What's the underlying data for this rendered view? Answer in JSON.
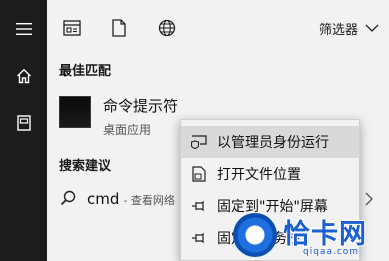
{
  "rail": {
    "items": [
      {
        "icon": "hamburger-menu-icon"
      },
      {
        "icon": "home-icon"
      },
      {
        "icon": "documents-icon"
      }
    ]
  },
  "topbar": {
    "icons": [
      "apps-icon",
      "document-icon",
      "web-icon"
    ],
    "filter_label": "筛选器"
  },
  "best_match": {
    "heading": "最佳匹配",
    "app_name": "命令提示符",
    "app_type": "桌面应用"
  },
  "suggestions": {
    "heading": "搜索建议",
    "query": "cmd",
    "sub": "- 查看网络"
  },
  "context_menu": {
    "items": [
      {
        "label": "以管理员身份运行",
        "icon": "shield-run-icon"
      },
      {
        "label": "打开文件位置",
        "icon": "open-folder-icon"
      },
      {
        "label": "固定到\"开始\"屏幕",
        "icon": "pin-icon"
      },
      {
        "label": "固定到任务栏",
        "icon": "pin-icon"
      }
    ]
  },
  "watermark": {
    "text": "恰卡网",
    "url": "qiqaa.com"
  }
}
